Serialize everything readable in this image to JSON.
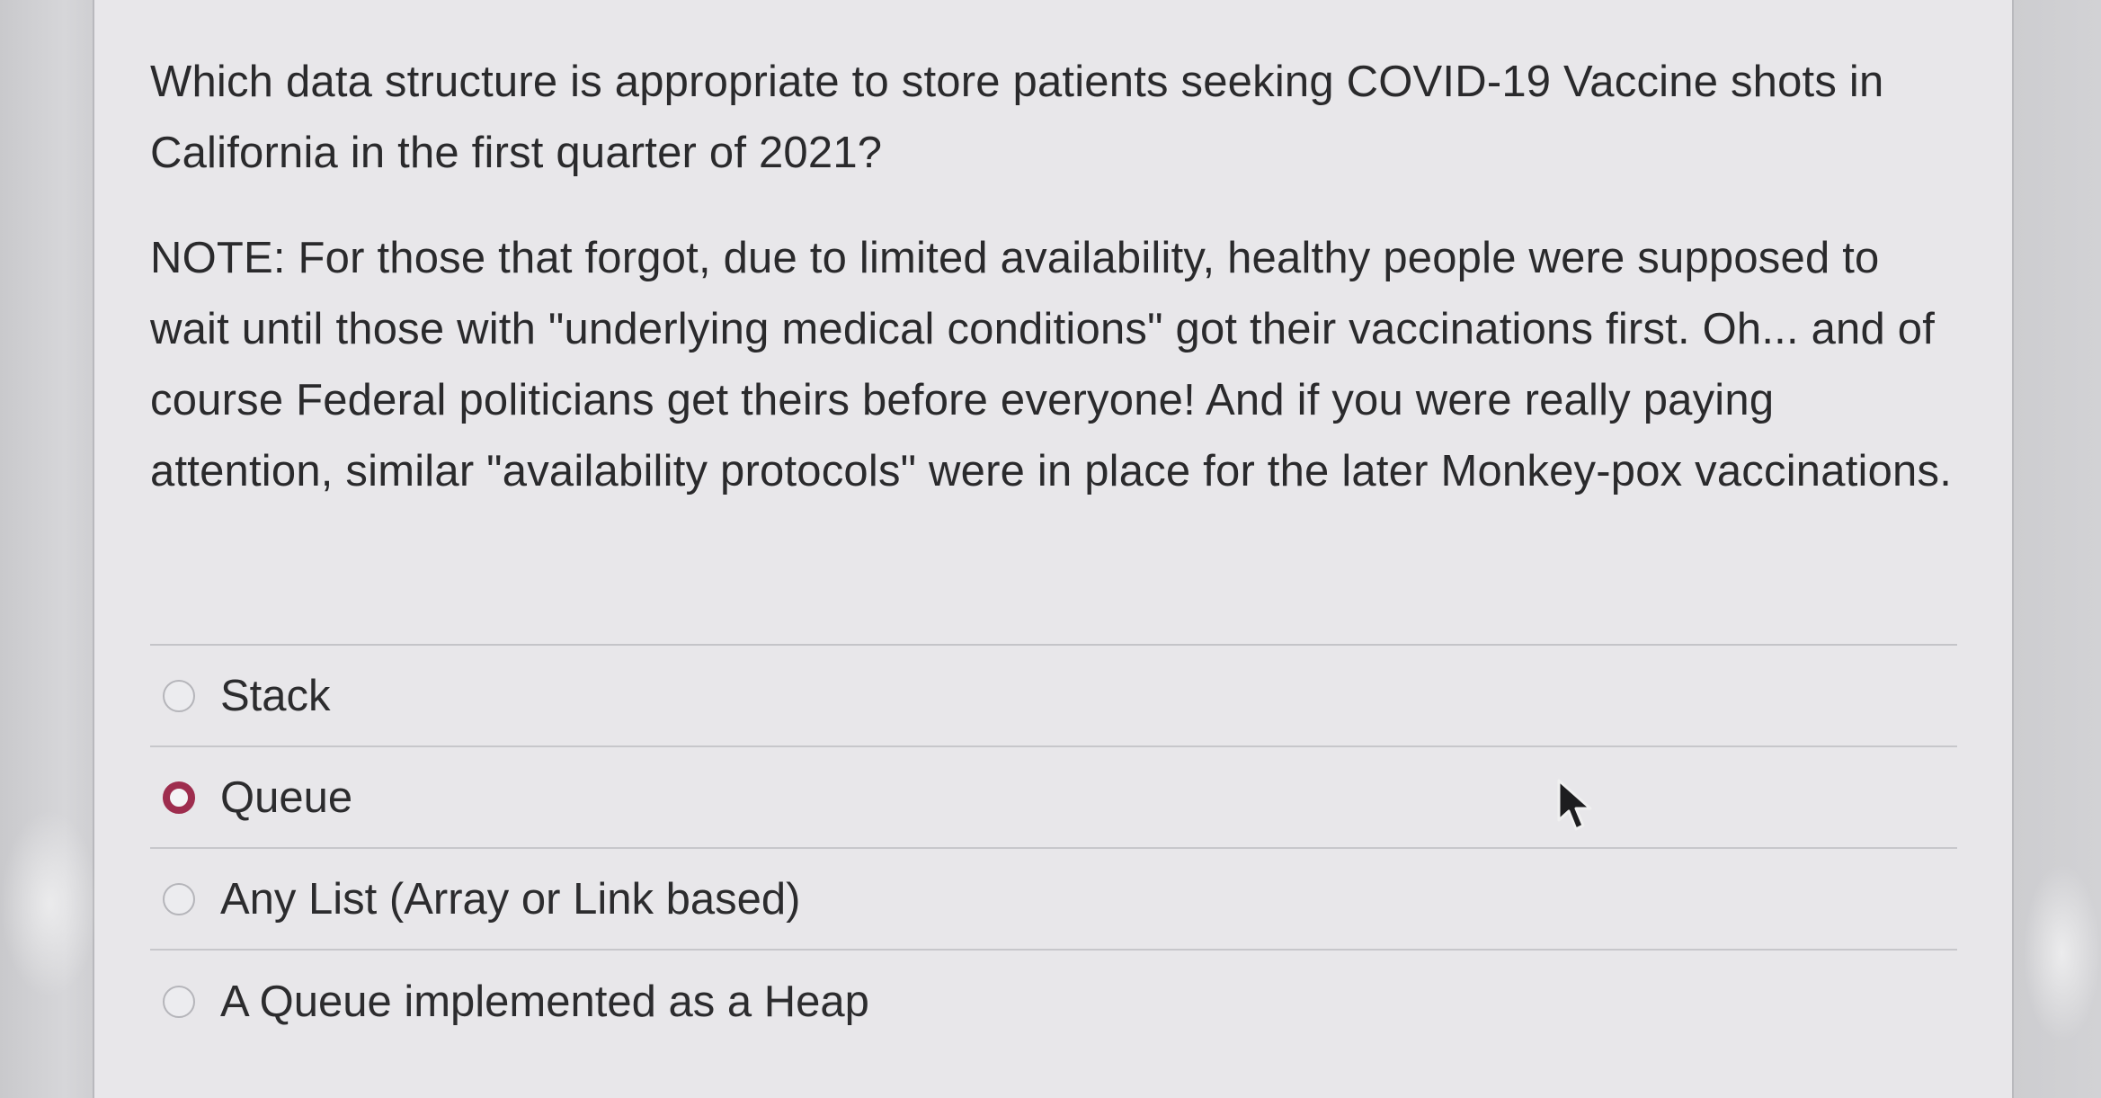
{
  "question": {
    "prompt": "Which data structure is appropriate to store patients seeking COVID-19 Vaccine shots in California in the first quarter of 2021?",
    "note": "NOTE:  For those that forgot, due to limited availability, healthy people were supposed to wait until those with \"underlying medical conditions\" got their vaccinations first.  Oh... and of course Federal politicians get theirs before everyone!  And if you were really paying attention, similar \"availability protocols\" were in place for the later Monkey-pox vaccinations."
  },
  "answers": [
    {
      "label": "Stack",
      "selected": false
    },
    {
      "label": "Queue",
      "selected": true
    },
    {
      "label": "Any List (Array or Link based)",
      "selected": false
    },
    {
      "label": "A Queue implemented as a Heap",
      "selected": false
    }
  ],
  "colors": {
    "radio_selected": "#9e2d4e",
    "card_background": "#e8e7ea",
    "text": "#2a2a2c"
  },
  "icons": {
    "cursor": "mouse-pointer-icon"
  }
}
